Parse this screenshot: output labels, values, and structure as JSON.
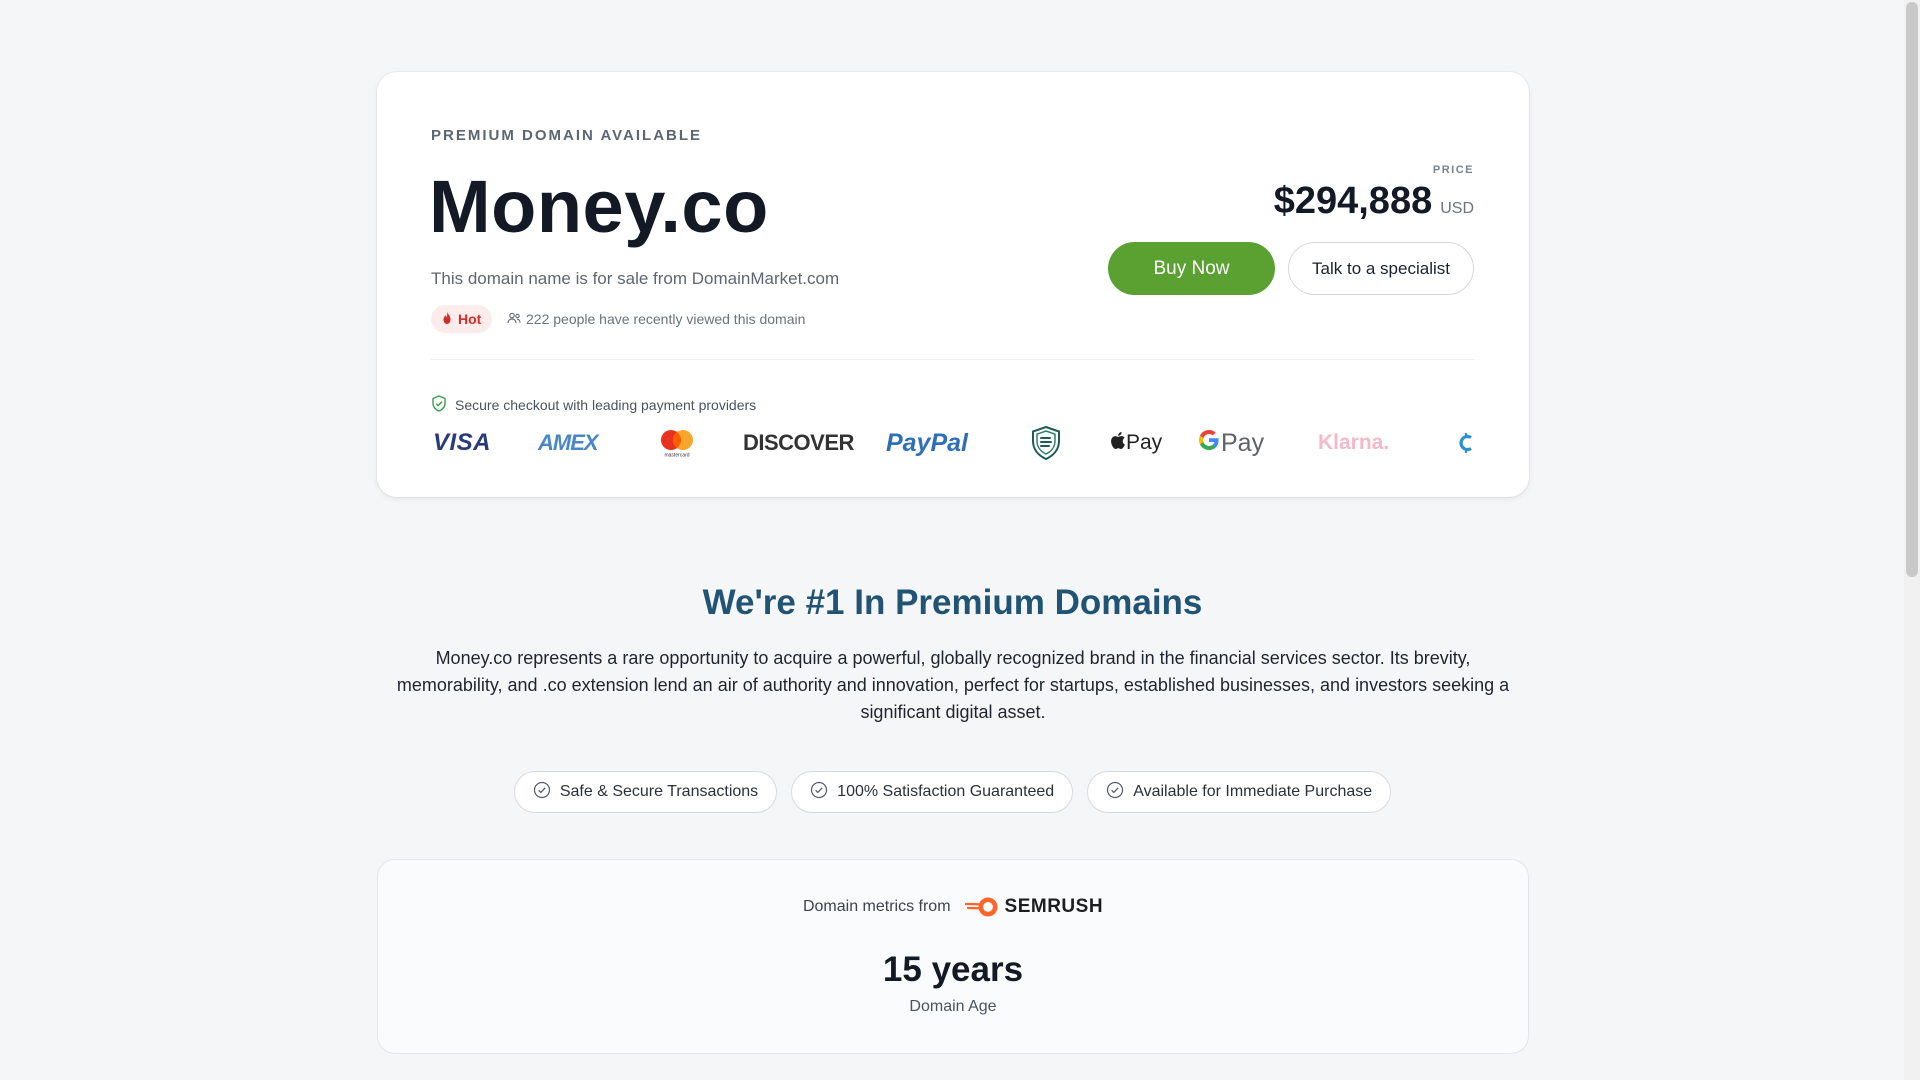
{
  "hero": {
    "eyebrow": "PREMIUM DOMAIN AVAILABLE",
    "domain": "Money.co",
    "subtitle": "This domain name is for sale from DomainMarket.com",
    "hot_badge": "Hot",
    "viewers_text": "222 people have recently viewed this domain",
    "price_label": "PRICE",
    "price": "$294,888",
    "currency": "USD",
    "buy_label": "Buy Now",
    "talk_label": "Talk to a specialist"
  },
  "checkout": {
    "secure_text": "Secure checkout with leading payment providers",
    "providers": {
      "visa": "VISA",
      "amex": "AMEX",
      "mastercard": "mastercard",
      "discover": "DISCOVER",
      "paypal": "PayPal",
      "apple_pay": "Pay",
      "google_pay": "Pay",
      "klarna": "Klarna."
    }
  },
  "about": {
    "title": "We're #1 In Premium Domains",
    "description": "Money.co represents a rare opportunity to acquire a powerful, globally recognized brand in the financial services sector. Its brevity, memorability, and .co extension lend an air of authority and innovation, perfect for startups, established businesses, and investors seeking a significant digital asset."
  },
  "pills": [
    {
      "label": "Safe & Secure Transactions"
    },
    {
      "label": "100% Satisfaction Guaranteed"
    },
    {
      "label": "Available for Immediate Purchase"
    }
  ],
  "metrics": {
    "header": "Domain metrics from",
    "brand": "SEMRUSH",
    "value": "15 years",
    "label": "Domain Age"
  },
  "colors": {
    "accent_green": "#5aa132",
    "heading_blue": "#215474",
    "hot_red": "#d62b2b",
    "semrush_orange": "#ff642d"
  }
}
